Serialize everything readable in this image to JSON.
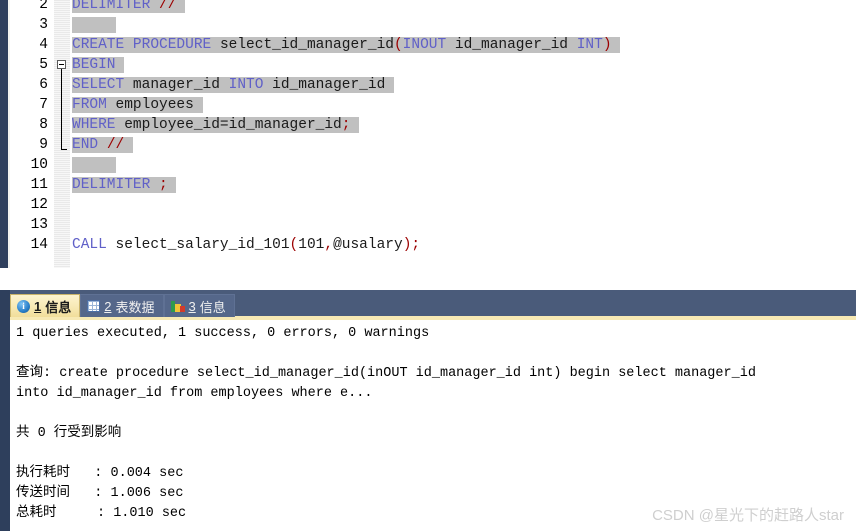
{
  "editor": {
    "lines": [
      {
        "num": "2",
        "segments": [
          {
            "t": "DELIMITER ",
            "c": "kw"
          },
          {
            "t": "//",
            "c": "op"
          }
        ],
        "selected": true
      },
      {
        "num": "3",
        "segments": [
          {
            "t": "",
            "c": "pl"
          }
        ],
        "selected": true
      },
      {
        "num": "4",
        "segments": [
          {
            "t": "CREATE PROCEDURE ",
            "c": "kw"
          },
          {
            "t": "select_id_manager_id",
            "c": "pl"
          },
          {
            "t": "(",
            "c": "op"
          },
          {
            "t": "INOUT ",
            "c": "kw"
          },
          {
            "t": "id_manager_id ",
            "c": "pl"
          },
          {
            "t": "INT",
            "c": "kw"
          },
          {
            "t": ")",
            "c": "op"
          }
        ],
        "selected": true
      },
      {
        "num": "5",
        "segments": [
          {
            "t": "BEGIN",
            "c": "kw"
          }
        ],
        "selected": true
      },
      {
        "num": "6",
        "segments": [
          {
            "t": "SELECT ",
            "c": "kw"
          },
          {
            "t": "manager_id ",
            "c": "pl"
          },
          {
            "t": "INTO ",
            "c": "kw"
          },
          {
            "t": "id_manager_id",
            "c": "pl"
          }
        ],
        "selected": true
      },
      {
        "num": "7",
        "segments": [
          {
            "t": "FROM ",
            "c": "kw"
          },
          {
            "t": "employees",
            "c": "pl"
          }
        ],
        "selected": true
      },
      {
        "num": "8",
        "segments": [
          {
            "t": "WHERE ",
            "c": "kw"
          },
          {
            "t": "employee_id=id_manager_id",
            "c": "pl"
          },
          {
            "t": ";",
            "c": "op"
          }
        ],
        "selected": true
      },
      {
        "num": "9",
        "segments": [
          {
            "t": "END ",
            "c": "kw"
          },
          {
            "t": "//",
            "c": "op"
          }
        ],
        "selected": true
      },
      {
        "num": "10",
        "segments": [
          {
            "t": "",
            "c": "pl"
          }
        ],
        "selected": true
      },
      {
        "num": "11",
        "segments": [
          {
            "t": "DELIMITER ",
            "c": "kw"
          },
          {
            "t": ";",
            "c": "op"
          }
        ],
        "selected": true
      },
      {
        "num": "12",
        "segments": [
          {
            "t": "",
            "c": "pl"
          }
        ],
        "selected": false
      },
      {
        "num": "13",
        "segments": [
          {
            "t": "",
            "c": "pl"
          }
        ],
        "selected": false
      },
      {
        "num": "14",
        "segments": [
          {
            "t": "CALL ",
            "c": "kw"
          },
          {
            "t": "select_salary_id_101",
            "c": "pl"
          },
          {
            "t": "(",
            "c": "op"
          },
          {
            "t": "101",
            "c": "pl"
          },
          {
            "t": ",",
            "c": "op"
          },
          {
            "t": "@usalary",
            "c": "pl"
          },
          {
            "t": ")",
            "c": "op"
          },
          {
            "t": ";",
            "c": "op"
          }
        ],
        "selected": false
      }
    ],
    "fold_marker_line": "5",
    "fold_end_line": "9",
    "scrollbar": {
      "orientation": "horizontal"
    }
  },
  "results": {
    "tabs": [
      {
        "num": "1",
        "label": "信息",
        "icon": "info-icon",
        "active": true
      },
      {
        "num": "2",
        "label": "表数据",
        "icon": "grid-icon",
        "active": false
      },
      {
        "num": "3",
        "label": "信息",
        "icon": "chart-icon",
        "active": false
      }
    ],
    "lines": [
      "1 queries executed, 1 success, 0 errors, 0 warnings",
      "",
      "查询: create procedure select_id_manager_id(inOUT id_manager_id int) begin select manager_id",
      "into id_manager_id from employees where e...",
      "",
      "共 0 行受到影响",
      "",
      "执行耗时   : 0.004 sec",
      "传送时间   : 1.006 sec",
      "总耗时     : 1.010 sec"
    ]
  },
  "watermark": {
    "text": "CSDN @星光下的赶路人star"
  },
  "colors": {
    "keyword": "#6060c8",
    "operator": "#9c0000",
    "selection": "#c0c0c0",
    "frame": "#2e3f5c",
    "tabbar": "#4a5b7a",
    "active_tab": "#f7e9b4"
  }
}
